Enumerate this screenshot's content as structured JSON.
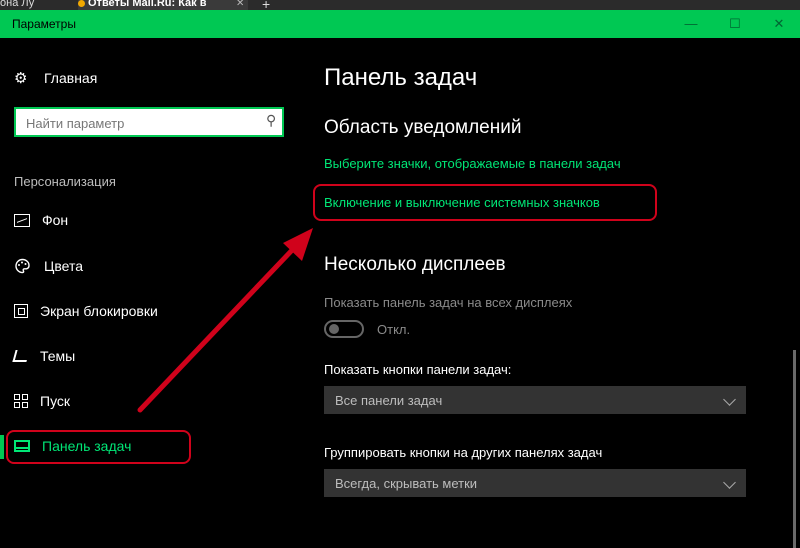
{
  "browser": {
    "tab1": "она Лу",
    "tab2": "Ответы Mail.Ru: Как в",
    "new_tab_icon": "plus-icon"
  },
  "window": {
    "title": "Параметры",
    "controls": [
      "minimize-icon",
      "maximize-icon",
      "close-icon"
    ]
  },
  "sidebar": {
    "home": "Главная",
    "search": {
      "placeholder": "Найти параметр",
      "value": ""
    },
    "section": "Персонализация",
    "items": [
      {
        "label": "Фон",
        "icon": "picture-icon"
      },
      {
        "label": "Цвета",
        "icon": "palette-icon"
      },
      {
        "label": "Экран блокировки",
        "icon": "lock-screen-icon"
      },
      {
        "label": "Темы",
        "icon": "theme-brush-icon"
      },
      {
        "label": "Пуск",
        "icon": "start-grid-icon"
      },
      {
        "label": "Панель задач",
        "icon": "taskbar-icon",
        "active": true
      }
    ]
  },
  "content": {
    "page_title": "Панель задач",
    "notifications": {
      "heading": "Область уведомлений",
      "link1": "Выберите значки, отображаемые в панели задач",
      "link2": "Включение и выключение системных значков"
    },
    "multi_display": {
      "heading": "Несколько дисплеев",
      "show_all_label": "Показать панель задач на всех дисплеях",
      "toggle_state": "Откл.",
      "toggle_on": false,
      "buttons_label": "Показать кнопки панели задач:",
      "buttons_value": "Все панели задач",
      "group_label": "Группировать кнопки на других панелях задач",
      "group_value": "Всегда, скрывать метки"
    }
  },
  "colors": {
    "accent": "#00c853",
    "link": "#00e676",
    "annotation": "#d0021b",
    "background": "#000000"
  }
}
